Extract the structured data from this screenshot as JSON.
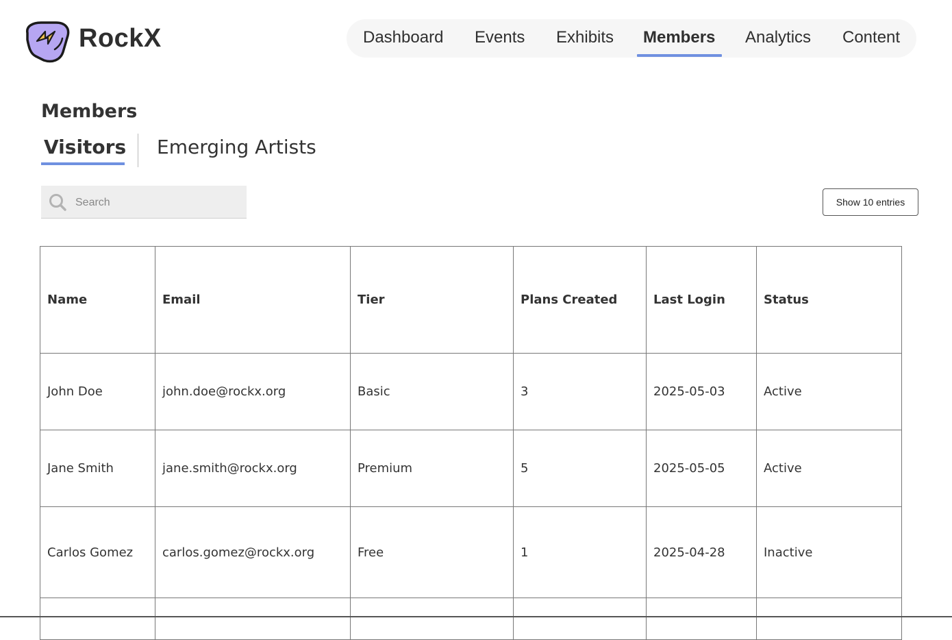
{
  "app": {
    "brand": "RockX"
  },
  "colors": {
    "accent": "#6f90e0",
    "logo_fill": "#b6a6f2",
    "logo_bolt": "#f3c24f"
  },
  "nav": {
    "items": [
      {
        "label": "Dashboard",
        "active": false
      },
      {
        "label": "Events",
        "active": false
      },
      {
        "label": "Exhibits",
        "active": false
      },
      {
        "label": "Members",
        "active": true
      },
      {
        "label": "Analytics",
        "active": false
      },
      {
        "label": "Content",
        "active": false
      }
    ]
  },
  "page": {
    "title": "Members"
  },
  "tabs": [
    {
      "label": "Visitors",
      "active": true
    },
    {
      "label": "Emerging Artists",
      "active": false
    }
  ],
  "search": {
    "placeholder": "Search",
    "value": "",
    "icon": "search-icon"
  },
  "entries_button": {
    "label": "Show 10 entries"
  },
  "table": {
    "headers": [
      "Name",
      "Email",
      "Tier",
      "Plans Created",
      "Last Login",
      "Status"
    ],
    "rows": [
      [
        "John Doe",
        "john.doe@rockx.org",
        "Basic",
        "3",
        "2025-05-03",
        "Active"
      ],
      [
        "Jane Smith",
        "jane.smith@rockx.org",
        "Premium",
        "5",
        "2025-05-05",
        "Active"
      ],
      [
        "Carlos Gomez",
        "carlos.gomez@rockx.org",
        "Free",
        "1",
        "2025-04-28",
        "Inactive"
      ]
    ]
  }
}
